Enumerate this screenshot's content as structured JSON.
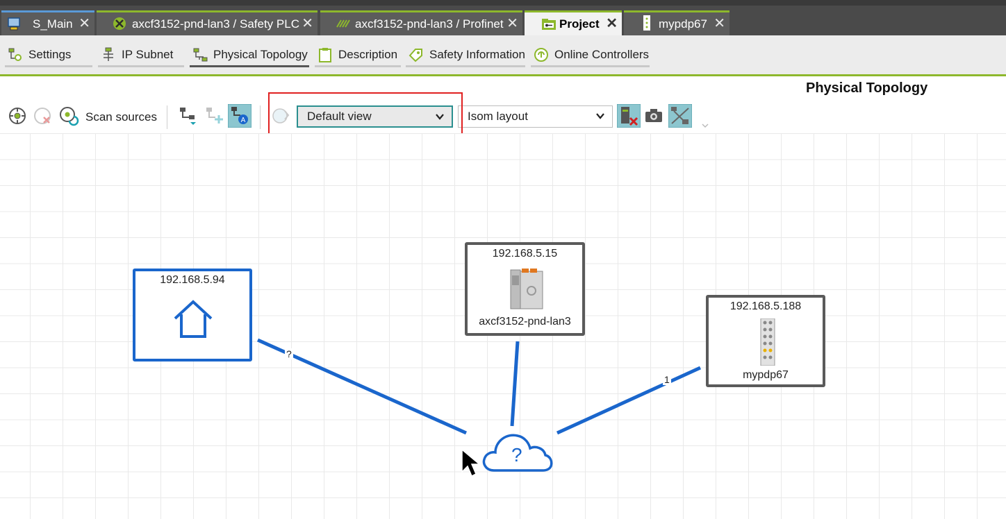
{
  "tabs": [
    {
      "label": "S_Main",
      "icon": "plc-screen-icon"
    },
    {
      "label": "axcf3152-pnd-lan3 / Safety PLC",
      "icon": "safety-plc-icon"
    },
    {
      "label": "axcf3152-pnd-lan3 / Profinet",
      "icon": "profinet-icon"
    },
    {
      "label": "Project",
      "icon": "project-folder-icon",
      "active": true
    },
    {
      "label": "mypdp67",
      "icon": "device-icon"
    }
  ],
  "close_glyph": "✕",
  "subtabs": [
    {
      "label": "Settings",
      "icon": "settings-network-icon"
    },
    {
      "label": "IP Subnet",
      "icon": "ip-subnet-icon"
    },
    {
      "label": "Physical Topology",
      "icon": "topology-icon",
      "active": true
    },
    {
      "label": "Description",
      "icon": "clipboard-icon"
    },
    {
      "label": "Safety Information",
      "icon": "safety-tag-icon"
    },
    {
      "label": "Online Controllers",
      "icon": "online-controller-icon"
    }
  ],
  "view_title": "Physical Topology",
  "toolbar": {
    "scan_label": "Scan sources",
    "view_select": "Default view",
    "layout_select": "Isom layout"
  },
  "nodes": {
    "home": {
      "ip": "192.168.5.94",
      "icon": "home-icon"
    },
    "plc": {
      "ip": "192.168.5.15",
      "name": "axcf3152-pnd-lan3"
    },
    "io": {
      "ip": "192.168.5.188",
      "name": "mypdp67"
    },
    "cloud": {
      "label": "?",
      "icon": "cloud-icon"
    }
  },
  "edges": {
    "home_cloud": "?",
    "io_cloud": "1"
  },
  "colors": {
    "accent_green": "#8db82c",
    "link_blue": "#1a66cc",
    "highlight_red": "#e02020"
  }
}
